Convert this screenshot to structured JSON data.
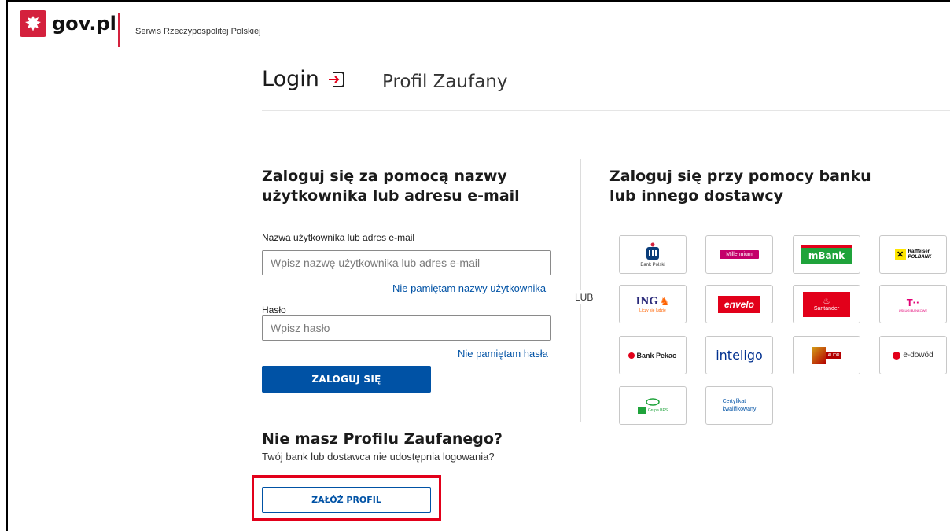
{
  "header": {
    "brand": "gov.pl",
    "subtitle": "Serwis Rzeczypospolitej Polskiej"
  },
  "title": {
    "login": "Login",
    "service": "Profil Zaufany"
  },
  "login_form": {
    "heading_line1": "Zaloguj się za pomocą nazwy",
    "heading_line2": "użytkownika lub adresu e-mail",
    "username_label": "Nazwa użytkownika lub adres e-mail",
    "username_placeholder": "Wpisz nazwę użytkownika lub adres e-mail",
    "forgot_username": "Nie pamiętam nazwy użytkownika",
    "password_label": "Hasło",
    "password_placeholder": "Wpisz hasło",
    "forgot_password": "Nie pamiętam hasła",
    "submit": "ZALOGUJ SIĘ"
  },
  "divider": "LUB",
  "providers_section": {
    "heading_line1": "Zaloguj się przy pomocy banku",
    "heading_line2": "lub innego dostawcy",
    "providers": [
      {
        "name": "PKO Bank Polski",
        "text": "Bank Polski"
      },
      {
        "name": "Millennium",
        "text": "Millennium"
      },
      {
        "name": "mBank",
        "text": "mBank"
      },
      {
        "name": "Raiffeisen Polbank",
        "text": "Raiffeisen",
        "text2": "POLBANK"
      },
      {
        "name": "ING",
        "text": "ING",
        "text2": "Liczy się ludzie"
      },
      {
        "name": "Envelo",
        "text": "envelo"
      },
      {
        "name": "Santander",
        "text": "Santander"
      },
      {
        "name": "T-Mobile",
        "text": "T··",
        "text2": "USŁUGI BANKOWE"
      },
      {
        "name": "Bank Pekao",
        "text": "Bank Pekao"
      },
      {
        "name": "Inteligo",
        "text": "inteligo"
      },
      {
        "name": "Alior Bank",
        "text": "ALIOR"
      },
      {
        "name": "e-dowód",
        "text": "e-dowód"
      },
      {
        "name": "Grupa BPS",
        "text": "Grupa BPS"
      },
      {
        "name": "Certyfikat kwalifikowany",
        "text": "Certyfikat",
        "text2": "kwalifikowany"
      }
    ]
  },
  "signup": {
    "heading": "Nie masz Profilu Zaufanego?",
    "subtext": "Twój bank lub dostawca nie udostępnia logowania?",
    "button": "ZAŁÓŻ PROFIL"
  },
  "colors": {
    "primary": "#0052a5",
    "brand_red": "#d4213d",
    "highlight": "#e2001a"
  }
}
